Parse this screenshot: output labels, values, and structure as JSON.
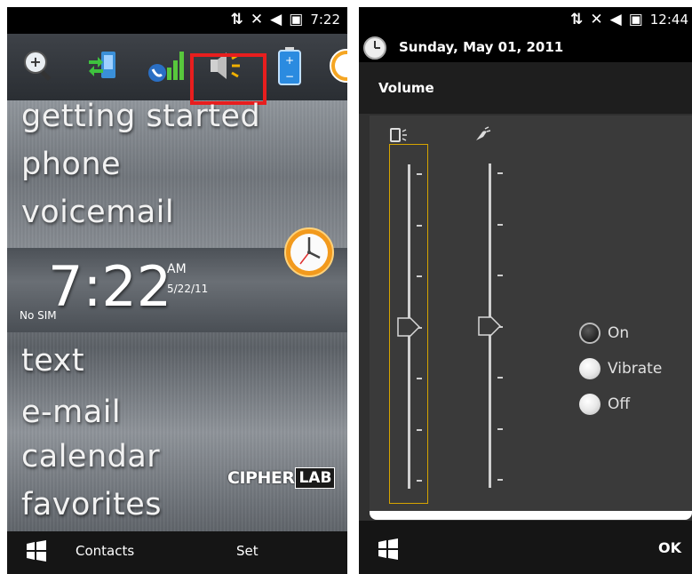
{
  "left": {
    "status_time": "7:22",
    "menu_items": [
      "getting started",
      "phone",
      "voicemail",
      "text",
      "e-mail",
      "calendar",
      "favorites"
    ],
    "clock": {
      "time": "7:22",
      "ampm": "AM",
      "date": "5/22/11",
      "sim": "No SIM"
    },
    "brand": {
      "part1": "CIPHER",
      "part2": "LAB"
    },
    "bottom": {
      "left_label": "Contacts",
      "right_label": "Set"
    },
    "highlight_color": "#e81e1e",
    "icons": [
      "zoom-icon",
      "connectivity-icon",
      "signal-icon",
      "speaker-volume-icon",
      "battery-icon",
      "clock-icon"
    ]
  },
  "right": {
    "status_time": "12:44",
    "date": "Sunday, May 01, 2011",
    "title": "Volume",
    "radios": [
      {
        "label": "On",
        "selected": true
      },
      {
        "label": "Vibrate",
        "selected": false
      },
      {
        "label": "Off",
        "selected": false
      }
    ],
    "sliders": [
      {
        "name": "system-volume",
        "icon": "speaker-phone-icon",
        "level": 0.5,
        "selected": true
      },
      {
        "name": "ring-volume",
        "icon": "ringer-icon",
        "level": 0.5,
        "selected": false
      }
    ],
    "ok_label": "OK",
    "selection_color": "#d6a400"
  }
}
